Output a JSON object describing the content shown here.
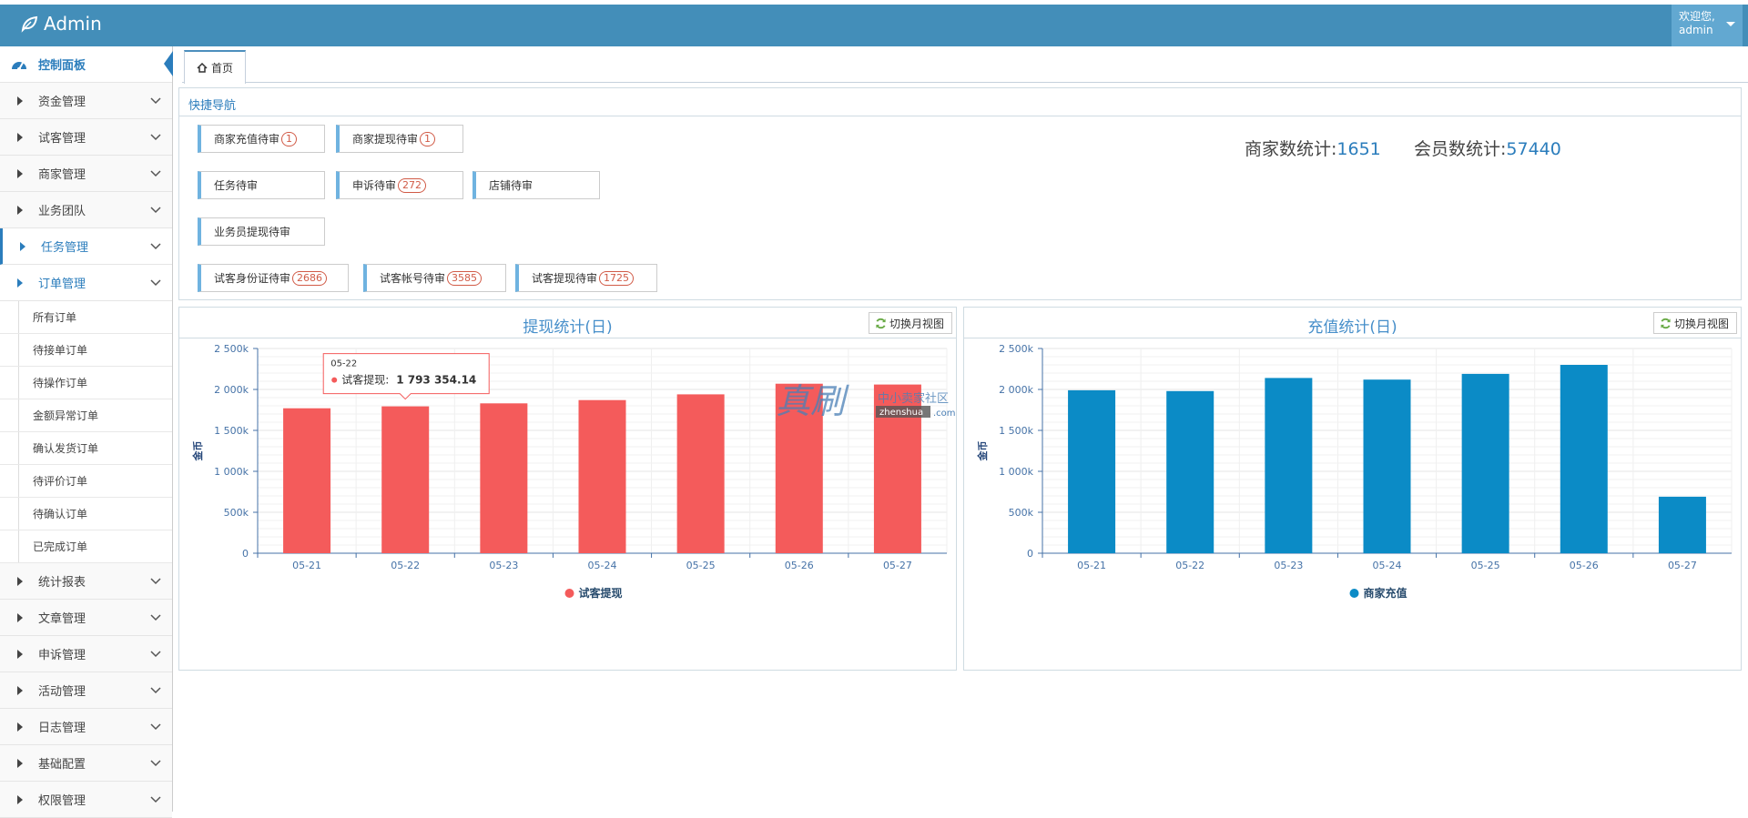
{
  "header": {
    "brand": "Admin",
    "user_greeting": "欢迎您,",
    "user_name": "admin"
  },
  "sidebar": {
    "dashboard": "控制面板",
    "items_top": [
      "资金管理",
      "试客管理",
      "商家管理",
      "业务团队",
      "任务管理",
      "订单管理"
    ],
    "order_sub": [
      "所有订单",
      "待接单订单",
      "待操作订单",
      "金额异常订单",
      "确认发货订单",
      "待评价订单",
      "待确认订单",
      "已完成订单"
    ],
    "items_bottom": [
      "统计报表",
      "文章管理",
      "申诉管理",
      "活动管理",
      "日志管理",
      "基础配置",
      "权限管理"
    ]
  },
  "tabs": {
    "home": "首页"
  },
  "quicknav": {
    "title": "快捷导航",
    "rows": [
      [
        {
          "label": "商家充值待审",
          "badge": "1"
        },
        {
          "label": "商家提现待审",
          "badge": "1"
        }
      ],
      [
        {
          "label": "任务待审",
          "badge": ""
        },
        {
          "label": "申诉待审",
          "badge": "272"
        },
        {
          "label": "店铺待审",
          "badge": ""
        }
      ],
      [
        {
          "label": "业务员提现待审",
          "badge": ""
        }
      ],
      [
        {
          "label": "试客身份证待审",
          "badge": "2686"
        },
        {
          "label": "试客帐号待审",
          "badge": "3585"
        },
        {
          "label": "试客提现待审",
          "badge": "1725"
        }
      ]
    ],
    "merchant_label": "商家数统计:",
    "merchant_count": "1651",
    "member_label": "会员数统计:",
    "member_count": "57440"
  },
  "switch_label": "切换月视图",
  "tooltip": {
    "date": "05-22",
    "series": "试客提现",
    "value": "1 793 354.14"
  },
  "watermark": {
    "main": "真刷",
    "sub1": "中小卖家社区",
    "sub2": "zhenshua",
    "sub3": ".com"
  },
  "chart_data": [
    {
      "type": "bar",
      "title": "提现统计(日)",
      "ylabel": "金币",
      "categories": [
        "05-21",
        "05-22",
        "05-23",
        "05-24",
        "05-25",
        "05-26",
        "05-27"
      ],
      "series": [
        {
          "name": "试客提现",
          "values": [
            1770000,
            1793354.14,
            1830000,
            1870000,
            1940000,
            2070000,
            2060000
          ]
        }
      ],
      "ylim": [
        0,
        2500000
      ],
      "yticks": [
        "0",
        "500k",
        "1 000k",
        "1 500k",
        "2 000k",
        "2 500k"
      ],
      "color": "#f45b5b",
      "legend": "bottom"
    },
    {
      "type": "bar",
      "title": "充值统计(日)",
      "ylabel": "金币",
      "categories": [
        "05-21",
        "05-22",
        "05-23",
        "05-24",
        "05-25",
        "05-26",
        "05-27"
      ],
      "series": [
        {
          "name": "商家充值",
          "values": [
            1990000,
            1980000,
            2140000,
            2120000,
            2190000,
            2300000,
            690000
          ]
        }
      ],
      "ylim": [
        0,
        2500000
      ],
      "yticks": [
        "0",
        "500k",
        "1 000k",
        "1 500k",
        "2 000k",
        "2 500k"
      ],
      "color": "#0b8bc6",
      "legend": "bottom"
    }
  ]
}
